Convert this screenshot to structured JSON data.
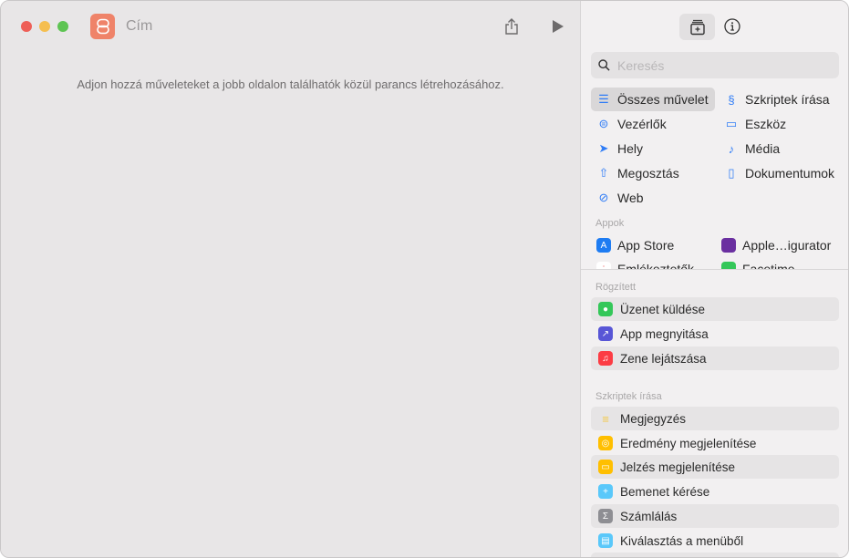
{
  "window": {
    "title": "Cím",
    "hint": "Adjon hozzá műveleteket a jobb oldalon találhatók közül parancs létrehozásához."
  },
  "sidebar": {
    "search_placeholder": "Keresés",
    "categories": [
      {
        "label": "Összes művelet",
        "icon": "list-icon"
      },
      {
        "label": "Szkriptek írása",
        "icon": "script-icon"
      },
      {
        "label": "Vezérlők",
        "icon": "toggle-icon"
      },
      {
        "label": "Eszköz",
        "icon": "display-icon"
      },
      {
        "label": "Hely",
        "icon": "location-icon"
      },
      {
        "label": "Média",
        "icon": "music-note-icon"
      },
      {
        "label": "Megosztás",
        "icon": "share-icon"
      },
      {
        "label": "Dokumentumok",
        "icon": "document-icon"
      },
      {
        "label": "Web",
        "icon": "compass-icon"
      }
    ],
    "apps_label": "Appok",
    "apps": [
      {
        "label": "App Store",
        "color": "#1e7cf2"
      },
      {
        "label": "Apple…igurator",
        "color": "#6a2fa0"
      },
      {
        "label": "Emlékeztetők",
        "color": "#ffffff"
      },
      {
        "label": "Facetime",
        "color": "#34c759"
      }
    ],
    "pinned_label": "Rögzített",
    "pinned": [
      {
        "label": "Üzenet küldése",
        "color": "#34c759"
      },
      {
        "label": "App megnyitása",
        "color": "#5856d6"
      },
      {
        "label": "Zene lejátszása",
        "color": "#fc3c44"
      }
    ],
    "scripting_label": "Szkriptek írása",
    "scripting": [
      {
        "label": "Megjegyzés",
        "color": "#f2c94c"
      },
      {
        "label": "Eredmény megjelenítése",
        "color": "#ffbf00"
      },
      {
        "label": "Jelzés megjelenítése",
        "color": "#ffbf00"
      },
      {
        "label": "Bemenet kérése",
        "color": "#5ac8fa"
      },
      {
        "label": "Számlálás",
        "color": "#8e8e93"
      },
      {
        "label": "Kiválasztás a menüből",
        "color": "#5ac8fa"
      }
    ]
  }
}
